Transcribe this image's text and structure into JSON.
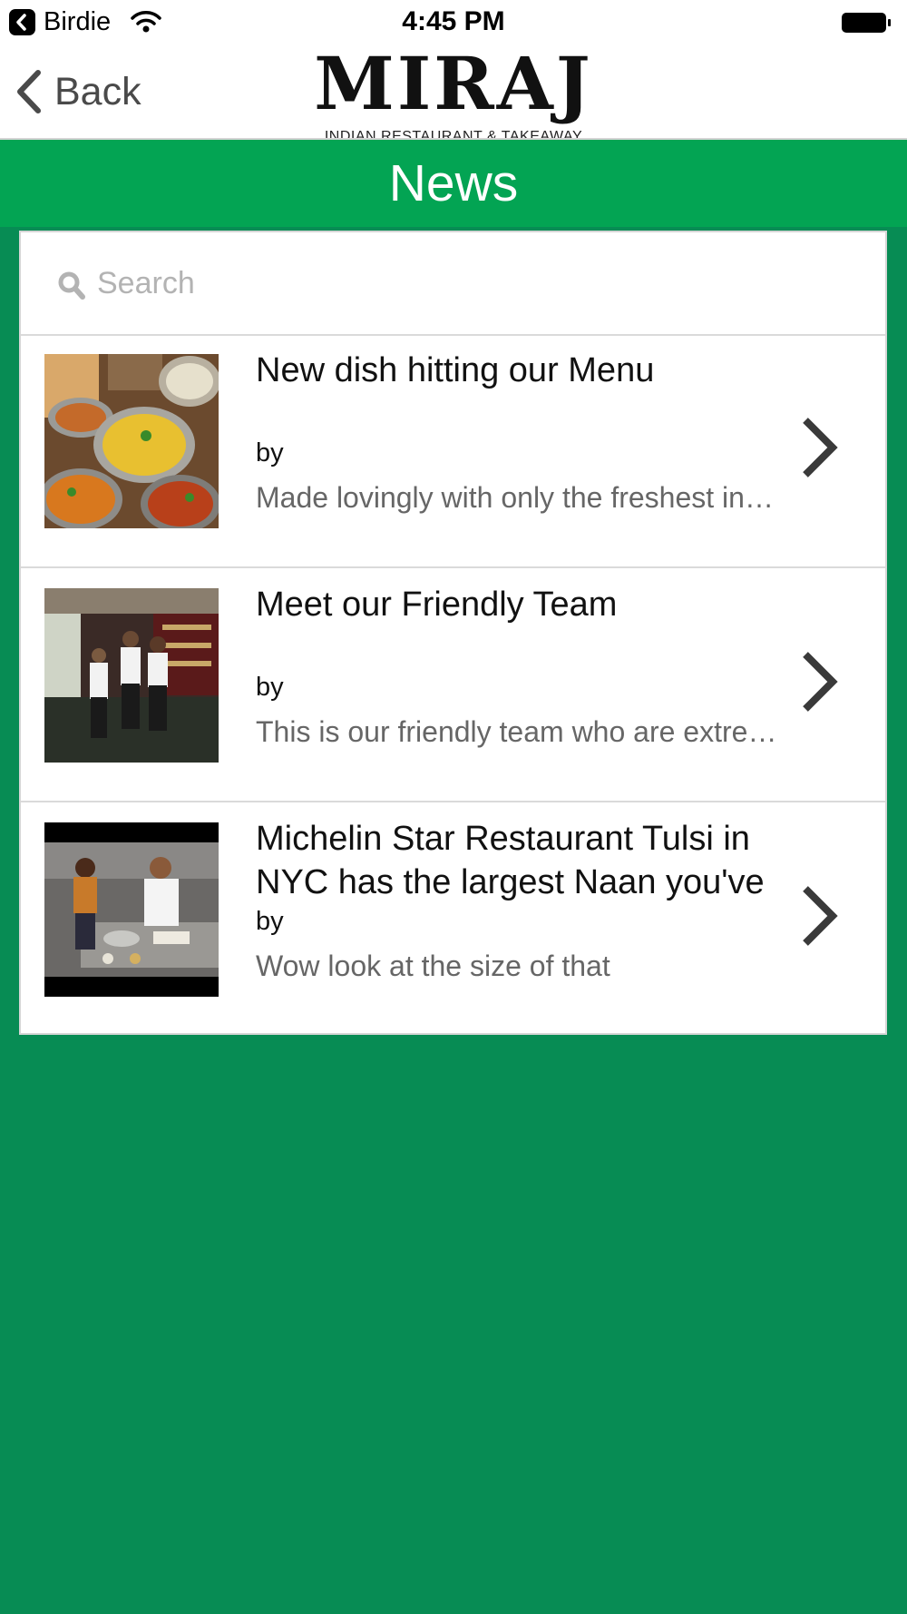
{
  "status_bar": {
    "carrier": "Birdie",
    "time": "4:45 PM"
  },
  "nav": {
    "back_label": "Back",
    "logo_title": "MIRAJ",
    "logo_subtitle": "INDIAN RESTAURANT & TAKEAWAY"
  },
  "page": {
    "title": "News"
  },
  "search": {
    "placeholder": "Search",
    "value": ""
  },
  "news": [
    {
      "title": "New dish hitting our Menu",
      "author": "by",
      "excerpt": "Made lovingly with only the freshest ingredients",
      "thumbnail_icon": "curry-dishes-photo"
    },
    {
      "title": "Meet our Friendly Team",
      "author": "by",
      "excerpt": "This is our friendly team who are extremely welcoming",
      "thumbnail_icon": "team-photo"
    },
    {
      "title": "Michelin Star Restaurant Tulsi in NYC has the largest Naan you've",
      "author": "by",
      "excerpt": "Wow look at the size of that",
      "thumbnail_icon": "chef-video-photo"
    }
  ],
  "colors": {
    "title_bar": "#03a453",
    "background": "#078c54",
    "chevron": "#3a3a3a"
  }
}
